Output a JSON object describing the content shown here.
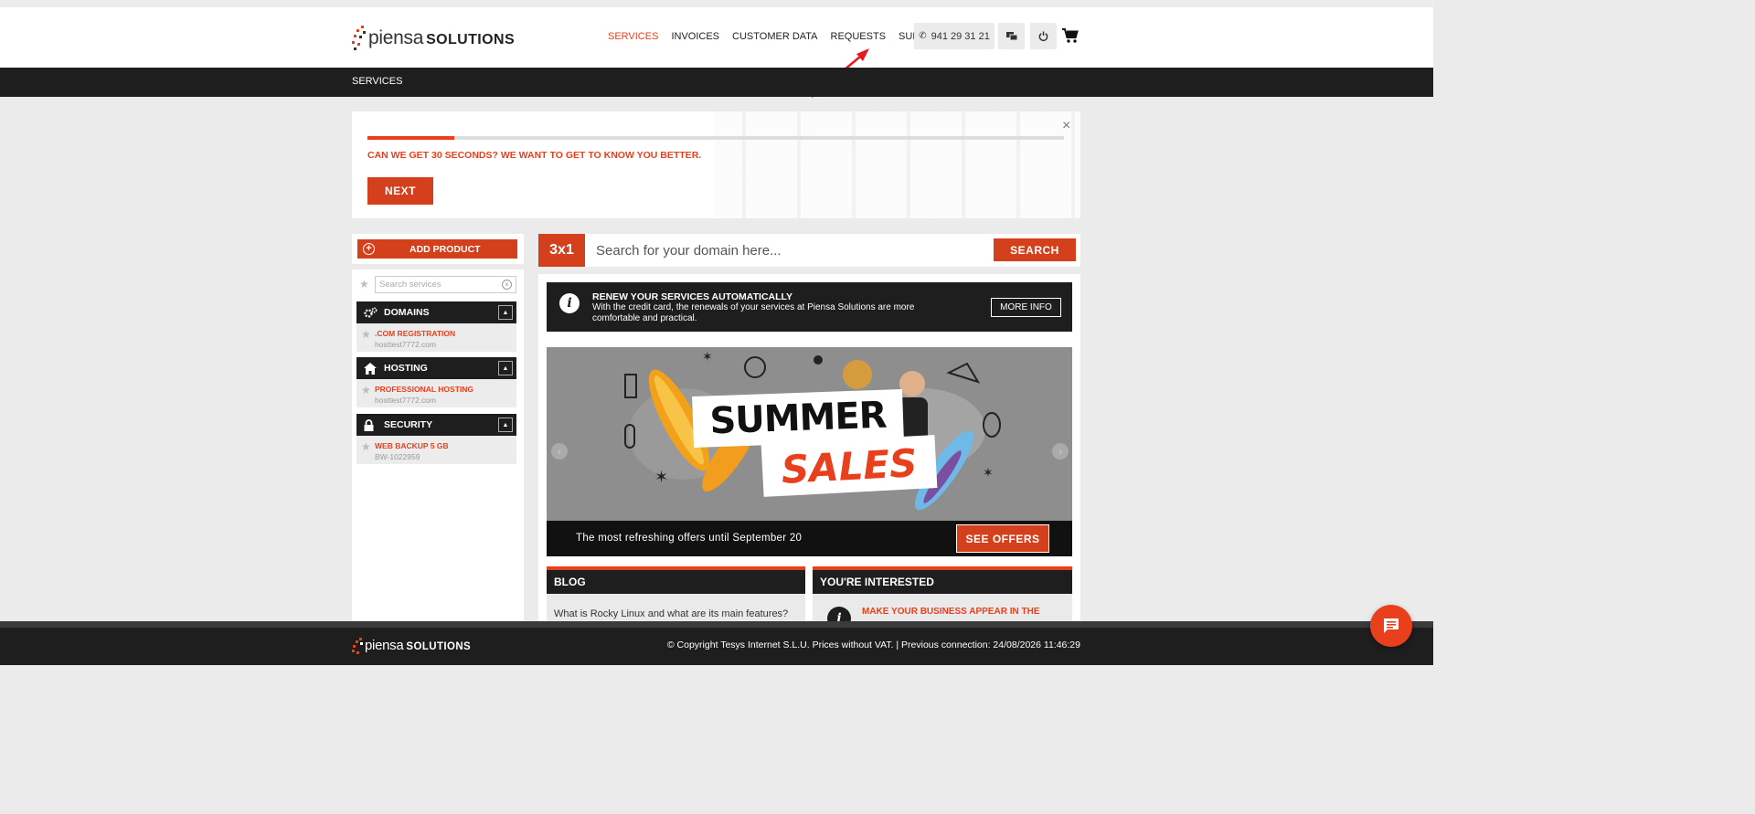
{
  "brand": {
    "name_light": "piensa",
    "name_bold": "SOLUTIONS"
  },
  "nav": {
    "items": [
      {
        "label": "SERVICES",
        "active": true
      },
      {
        "label": "INVOICES",
        "active": false
      },
      {
        "label": "CUSTOMER DATA",
        "active": false
      },
      {
        "label": "REQUESTS",
        "active": false
      },
      {
        "label": "SUPPORT",
        "active": false
      }
    ],
    "phone": "941 29 31 21",
    "phone_icon": "phone-icon",
    "chat_icon": "chat-bubbles-icon",
    "power_icon": "power-icon",
    "cart_icon": "cart-icon"
  },
  "breadcrumb": {
    "current": "SERVICES"
  },
  "survey": {
    "question": "CAN WE GET 30 SECONDS? WE WANT TO GET TO KNOW YOU BETTER.",
    "next_label": "NEXT",
    "progress": 0.125,
    "close_symbol": "×"
  },
  "sidebar": {
    "add_label": "ADD PRODUCT",
    "search_placeholder": "Search services",
    "categories": [
      {
        "title": "DOMAINS",
        "icon": "gears-icon",
        "item_name": ".COM REGISTRATION",
        "item_sub": "hosttest7772.com"
      },
      {
        "title": "HOSTING",
        "icon": "home-icon",
        "item_name": "PROFESSIONAL HOSTING",
        "item_sub": "hosttest7772.com"
      },
      {
        "title": "SECURITY",
        "icon": "lock-icon",
        "item_name": "WEB BACKUP 5 GB",
        "item_sub": "BW-1022959"
      }
    ]
  },
  "domain_search": {
    "tag": "3x1",
    "placeholder": "Search for your domain here...",
    "button": "SEARCH"
  },
  "info": {
    "title": "RENEW YOUR SERVICES AUTOMATICALLY",
    "text": "With the credit card, the renewals of your services at Piensa Solutions are more comfortable and practical.",
    "button": "MORE INFO",
    "icon": "i"
  },
  "banner": {
    "word1": "SUMMER",
    "word2": "SALES",
    "caption": "The most refreshing offers until September 20",
    "button": "SEE OFFERS",
    "prev": "‹",
    "next": "›"
  },
  "panels": {
    "blog_title": "BLOG",
    "blog_item": "What is Rocky Linux and what are its main features?",
    "interest_title": "YOU'RE INTERESTED",
    "interest_item": "MAKE YOUR BUSINESS APPEAR IN THE"
  },
  "footer": {
    "copyright": "© Copyright Tesys Internet S.L.U. Prices without VAT. | Previous connection: 24/08/2026 11:46:29"
  },
  "colors": {
    "accent": "#e8401c",
    "dark": "#1e1e1e",
    "bg": "#ebebeb"
  }
}
